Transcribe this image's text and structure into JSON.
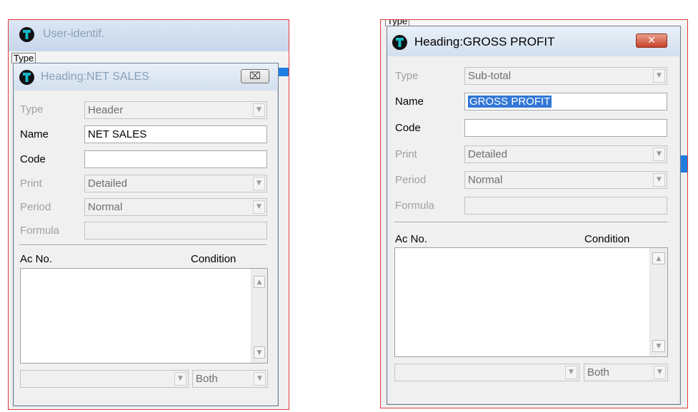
{
  "left": {
    "background_title": "User-identif.",
    "tab_label": "Type",
    "dialog": {
      "title": "Heading:NET SALES",
      "close_glyph": "⌧",
      "fields": {
        "type": {
          "label": "Type",
          "value": "Header"
        },
        "name": {
          "label": "Name",
          "value": "NET SALES"
        },
        "code": {
          "label": "Code",
          "value": ""
        },
        "print": {
          "label": "Print",
          "value": "Detailed"
        },
        "period": {
          "label": "Period",
          "value": "Normal"
        },
        "formula": {
          "label": "Formula",
          "value": ""
        }
      },
      "list_headers": {
        "ac_no": "Ac No.",
        "condition": "Condition"
      },
      "bottom_left_value": "",
      "bottom_right_value": "Both"
    }
  },
  "right": {
    "tab_label": "Type",
    "dialog": {
      "title": "Heading:GROSS PROFIT",
      "close_glyph": "✕",
      "fields": {
        "type": {
          "label": "Type",
          "value": "Sub-total"
        },
        "name": {
          "label": "Name",
          "value": "GROSS PROFIT"
        },
        "code": {
          "label": "Code",
          "value": ""
        },
        "print": {
          "label": "Print",
          "value": "Detailed"
        },
        "period": {
          "label": "Period",
          "value": "Normal"
        },
        "formula": {
          "label": "Formula",
          "value": ""
        }
      },
      "list_headers": {
        "ac_no": "Ac No.",
        "condition": "Condition"
      },
      "bottom_left_value": "",
      "bottom_right_value": "Both"
    }
  },
  "glyphs": {
    "combo_arrow": "▼",
    "scroll_up": "▲",
    "scroll_down": "▼"
  },
  "colors": {
    "frame_border": "#e03a3a",
    "selection": "#3377d6",
    "close_active": "#c7432a",
    "window_bg": "#f0f0f0"
  }
}
